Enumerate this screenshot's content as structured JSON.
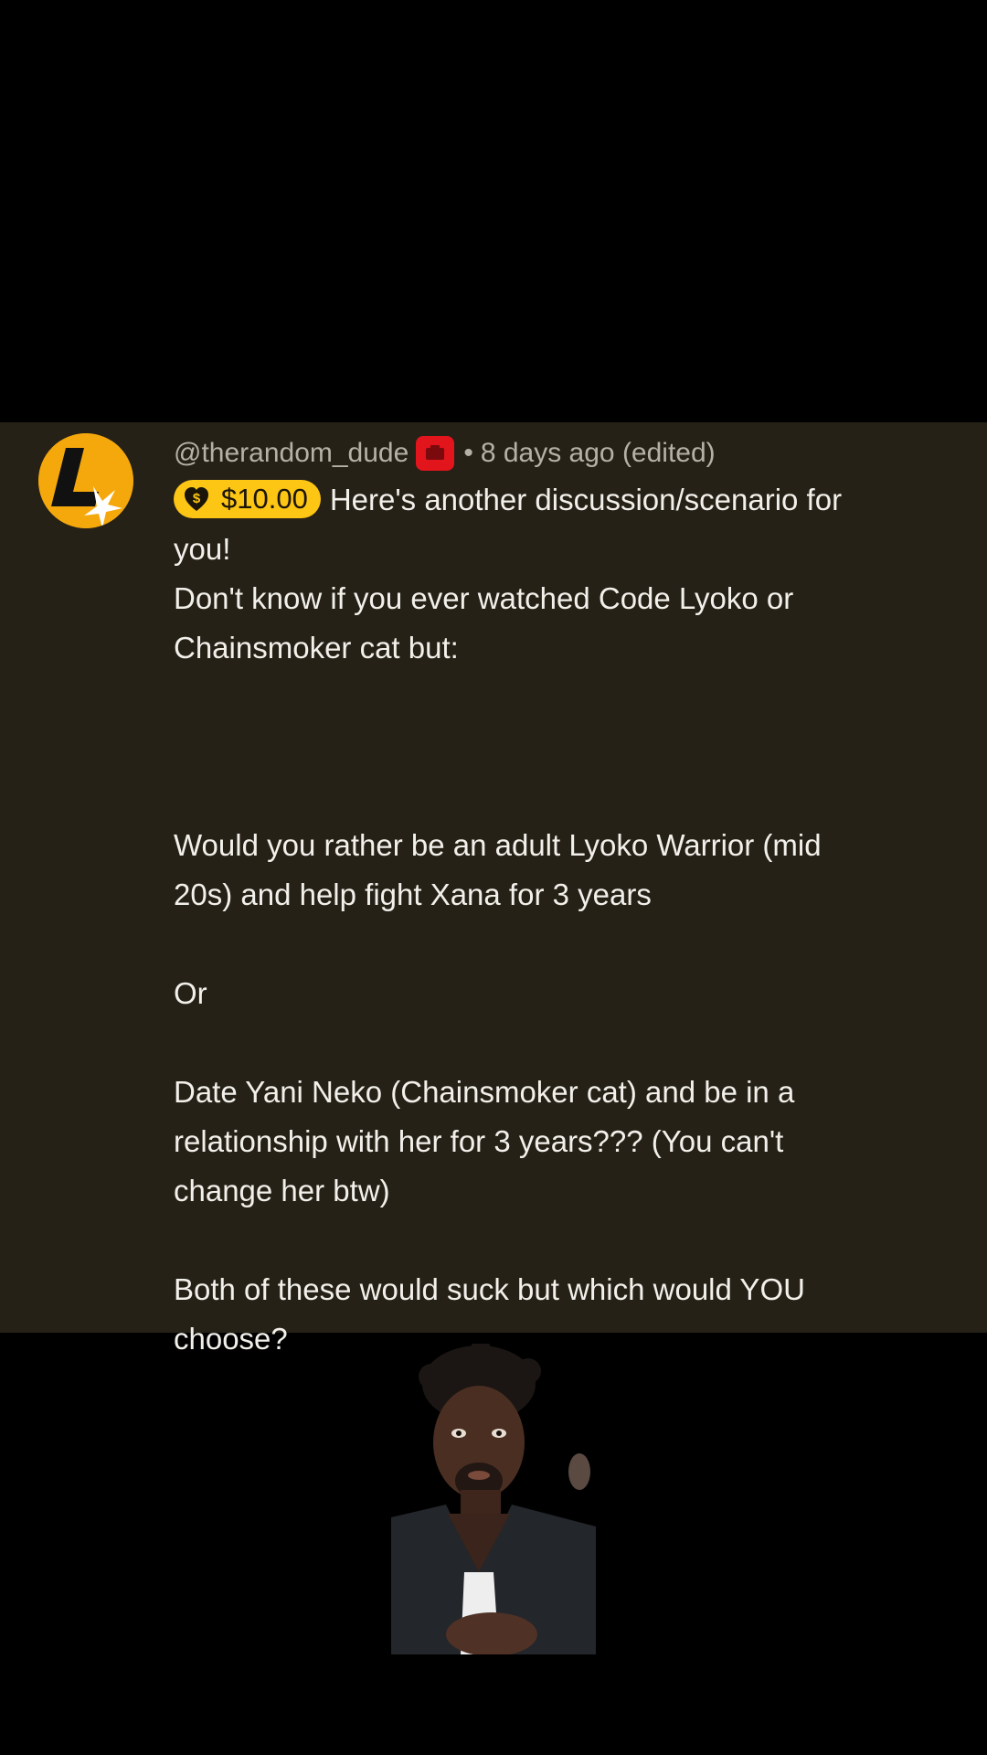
{
  "comment": {
    "author": "@therandom_dude",
    "timestamp": "8 days ago (edited)",
    "separator": "•",
    "superchat_amount": "$10.00",
    "lines": [
      "Here's another discussion/scenario for",
      "you!",
      "Don't know if you ever watched Code Lyoko or",
      "Chainsmoker cat but:",
      "",
      "",
      "",
      "Would you rather be an adult Lyoko Warrior  (mid",
      "20s) and help fight Xana for 3 years",
      "",
      "Or",
      "",
      "Date Yani Neko (Chainsmoker cat) and be in a",
      "relationship with her for 3 years??? (You can't",
      "change her btw)",
      "",
      "Both of these would suck but which would YOU",
      "choose?"
    ]
  },
  "colors": {
    "card_background": "#252117",
    "superchat_chip": "#fdc514",
    "avatar_orange": "#f5a80c",
    "member_badge_red": "#e2141c"
  },
  "icons": {
    "avatar": "letter-l-star-logo",
    "member_badge": "member-badge-icon",
    "superchat": "heart-dollar-icon"
  }
}
